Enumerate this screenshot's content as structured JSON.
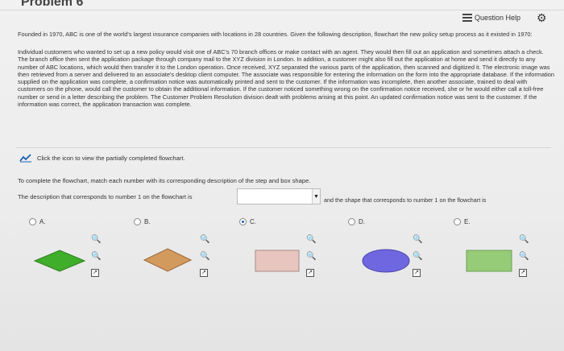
{
  "header": {
    "title": "Problem 6",
    "help_label": "Question Help"
  },
  "intro": "Founded in 1970, ABC is one of the world's largest insurance companies with locations in 28 countries. Given the following description, flowchart the new policy setup process as it existed in 1970:",
  "description": "Individual customers who wanted to set up a new policy would visit one of ABC's 70 branch offices or make contact with an agent. They would then fill out an application and sometimes attach a check. The branch office then sent the application package through company mail to the XYZ division in London. In addition, a customer might also fill out the application at home and send it directly to any number of ABC locations, which would then transfer it to the London operation. Once received, XYZ separated the various parts of the application, then scanned and digitized it. The electronic image was then retrieved from a server and delivered to an associate's desktop client computer. The associate was responsible for entering the information on the form into the appropriate database. If the information supplied on the application was complete, a confirmation notice was automatically printed and sent to the customer. If the information was incomplete, then another associate, trained to deal with customers on the phone, would call the customer to obtain the additional information. If the customer noticed something wrong on the confirmation notice received, she or he would either call a toll-free number or send in a letter describing the problem. The Customer Problem Resolution division dealt with problems arising at this point. An updated confirmation notice was sent to the customer. If the information was correct, the application transaction was complete.",
  "chart_link": "Click the icon to view the partially completed flowchart.",
  "instruction": "To complete the flowchart, match each number with its corresponding description of the step and box shape.",
  "question": {
    "desc_label": "The description that corresponds to number 1 on the flowchart is",
    "select_value": "",
    "shape_label": "and the shape that corresponds to number 1 on the flowchart is"
  },
  "options": [
    {
      "letter": "A.",
      "shape": "diamond",
      "color": "#3fae2a",
      "checked": false
    },
    {
      "letter": "B.",
      "shape": "diamond",
      "color": "#d39a5e",
      "checked": false
    },
    {
      "letter": "C.",
      "shape": "rectangle",
      "color": "#e9c5bf",
      "checked": true
    },
    {
      "letter": "D.",
      "shape": "ellipse",
      "color": "#6f67e0",
      "checked": false
    },
    {
      "letter": "E.",
      "shape": "rectangle",
      "color": "#96cc78",
      "checked": false
    }
  ]
}
